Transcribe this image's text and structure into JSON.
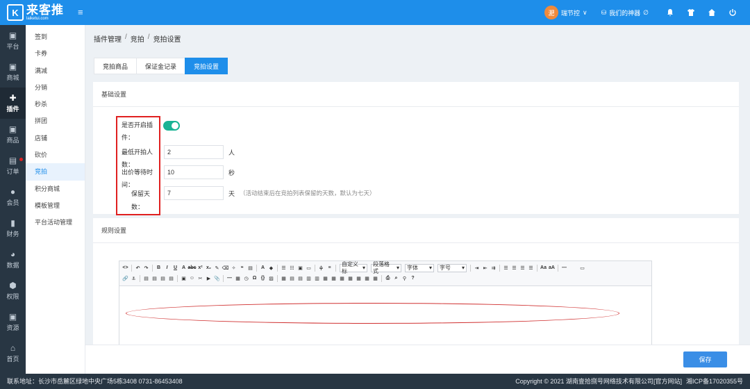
{
  "topbar": {
    "logo_mark": "K",
    "logo_title": "来客推",
    "logo_sub": "laiketui.com",
    "menu_toggle": "≡",
    "user_avatar_text": "淝",
    "user_name": "瑞节控",
    "user_caret": "∨",
    "store_name": "我们的神器",
    "store_icon": "⛁",
    "store_badge": "∅"
  },
  "sidebar": [
    {
      "label": "平台",
      "icon": "▣"
    },
    {
      "label": "商城",
      "icon": "▣"
    },
    {
      "label": "插件",
      "icon": "✚"
    },
    {
      "label": "商品",
      "icon": "▣"
    },
    {
      "label": "订单",
      "icon": "▤"
    },
    {
      "label": "会员",
      "icon": "●"
    },
    {
      "label": "财务",
      "icon": "▮"
    },
    {
      "label": "数据",
      "icon": "◕"
    },
    {
      "label": "权限",
      "icon": "⬢"
    },
    {
      "label": "资源",
      "icon": "▣"
    },
    {
      "label": "首页",
      "icon": "⌂"
    }
  ],
  "subnav": [
    "签到",
    "卡券",
    "满减",
    "分销",
    "秒杀",
    "拼团",
    "店铺",
    "砍价",
    "竞拍",
    "积分商城",
    "模板管理",
    "平台活动管理"
  ],
  "breadcrumb": {
    "c1": "插件管理",
    "c2": "竞拍",
    "c3": "竞拍设置",
    "sep": "/"
  },
  "tabs": [
    "竞拍商品",
    "保证金记录",
    "竞拍设置"
  ],
  "basic": {
    "title": "基础设置",
    "enable_label_1": "是否开启插",
    "enable_label_2": "件：",
    "min_label_1": "最低开拍人",
    "min_label_2": "数：",
    "min_value": "2",
    "min_unit": "人",
    "wait_label_1": "出价等待时",
    "wait_label_2": "间：",
    "wait_value": "10",
    "wait_unit": "秒",
    "keep_label_1": "保留天",
    "keep_label_2": "数：",
    "keep_value": "7",
    "keep_unit": "天",
    "keep_hint": "（活动结束后在竞拍列表保留的天数，默认为七天）"
  },
  "rules": {
    "title": "规则设置",
    "font_family": "自定义标",
    "paragraph": "段落格式",
    "font": "字体",
    "size": "字号"
  },
  "save_label": "保存",
  "footer": {
    "address": "联系地址：长沙市岳麓区绿地中央广场5栋3408 0731-86453408",
    "copyright": "Copyright © 2021 湖南壹拾捌号网络技术有限公司",
    "official": "[官方网站]",
    "icp": "湘ICP备17020355号"
  },
  "colors": {
    "primary": "#1e8eea",
    "sidebar": "#283643",
    "toggle_on": "#1ab394",
    "highlight": "#e02020"
  }
}
